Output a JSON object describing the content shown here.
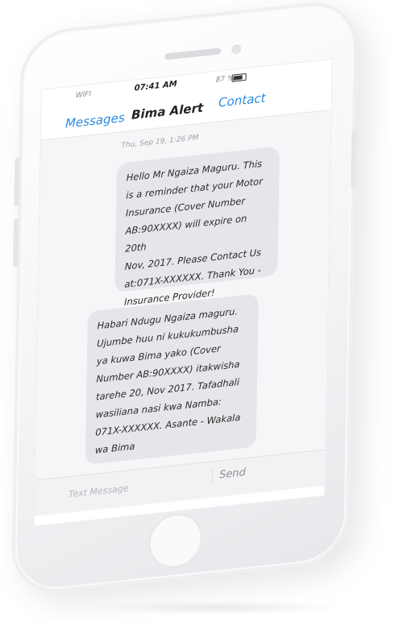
{
  "status_bar": {
    "network": "WIFI",
    "time": "07:41 AM",
    "battery_percent": "87 %"
  },
  "nav": {
    "back_label": "Messages",
    "title": "Bima Alert",
    "contact_label": "Contact"
  },
  "conversation": {
    "timestamp": "Thu, Sep 19, 1:26 PM",
    "messages": [
      {
        "text": "Hello Mr Ngaiza Maguru. This\nis a reminder that your Motor\nInsurance (Cover Number\nAB:90XXXX) will expire on 20th\nNov, 2017. Please Contact Us\nat:071X-XXXXXX. Thank You -\nInsurance Provider!"
      },
      {
        "text": "Habari Ndugu Ngaiza maguru.\nUjumbe huu ni kukukumbusha\nya kuwa Bima yako (Cover\nNumber AB:90XXXX) itakwisha\ntarehe 20, Nov 2017. Tafadhali\nwasiliana nasi kwa Namba:\n071X-XXXXXX. Asante - Wakala\nwa Bima"
      }
    ]
  },
  "composer": {
    "placeholder": "Text Message",
    "value": "",
    "send_label": "Send"
  },
  "colors": {
    "accent": "#2b8ae0",
    "bubble": "#e6e6ea"
  }
}
